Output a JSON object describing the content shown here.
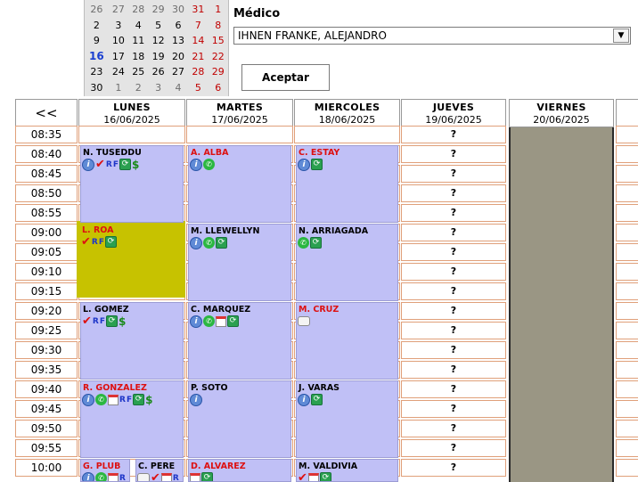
{
  "mini_calendar": {
    "weeks": [
      [
        {
          "d": "26",
          "c": "other"
        },
        {
          "d": "27",
          "c": "other"
        },
        {
          "d": "28",
          "c": "other"
        },
        {
          "d": "29",
          "c": "other"
        },
        {
          "d": "30",
          "c": "other"
        },
        {
          "d": "31",
          "c": "red other"
        },
        {
          "d": "1",
          "c": "red"
        }
      ],
      [
        {
          "d": "2",
          "c": ""
        },
        {
          "d": "3",
          "c": ""
        },
        {
          "d": "4",
          "c": ""
        },
        {
          "d": "5",
          "c": ""
        },
        {
          "d": "6",
          "c": ""
        },
        {
          "d": "7",
          "c": "red"
        },
        {
          "d": "8",
          "c": "red"
        }
      ],
      [
        {
          "d": "9",
          "c": ""
        },
        {
          "d": "10",
          "c": ""
        },
        {
          "d": "11",
          "c": ""
        },
        {
          "d": "12",
          "c": ""
        },
        {
          "d": "13",
          "c": ""
        },
        {
          "d": "14",
          "c": "red"
        },
        {
          "d": "15",
          "c": "red"
        }
      ],
      [
        {
          "d": "16",
          "c": "today"
        },
        {
          "d": "17",
          "c": ""
        },
        {
          "d": "18",
          "c": ""
        },
        {
          "d": "19",
          "c": ""
        },
        {
          "d": "20",
          "c": ""
        },
        {
          "d": "21",
          "c": "red"
        },
        {
          "d": "22",
          "c": "red"
        }
      ],
      [
        {
          "d": "23",
          "c": ""
        },
        {
          "d": "24",
          "c": ""
        },
        {
          "d": "25",
          "c": ""
        },
        {
          "d": "26",
          "c": ""
        },
        {
          "d": "27",
          "c": ""
        },
        {
          "d": "28",
          "c": "red"
        },
        {
          "d": "29",
          "c": "red"
        }
      ],
      [
        {
          "d": "30",
          "c": ""
        },
        {
          "d": "1",
          "c": "other"
        },
        {
          "d": "2",
          "c": "other"
        },
        {
          "d": "3",
          "c": "other"
        },
        {
          "d": "4",
          "c": "other"
        },
        {
          "d": "5",
          "c": "red other"
        },
        {
          "d": "6",
          "c": "red other"
        }
      ]
    ]
  },
  "medico": {
    "label": "Médico",
    "selected": "IHNEN FRANKE, ALEJANDRO",
    "accept_label": "Aceptar"
  },
  "schedule": {
    "nav_prev": "<<",
    "days": [
      {
        "name": "LUNES",
        "date": "16/06/2025"
      },
      {
        "name": "MARTES",
        "date": "17/06/2025"
      },
      {
        "name": "MIERCOLES",
        "date": "18/06/2025"
      },
      {
        "name": "JUEVES",
        "date": "19/06/2025"
      },
      {
        "name": "VIERNES",
        "date": "20/06/2025"
      }
    ],
    "times": [
      "08:35",
      "08:40",
      "08:45",
      "08:50",
      "08:55",
      "09:00",
      "09:05",
      "09:10",
      "09:15",
      "09:20",
      "09:25",
      "09:30",
      "09:35",
      "09:40",
      "09:45",
      "09:50",
      "09:55",
      "10:00"
    ],
    "unassigned_symbol": "?",
    "appointments": [
      {
        "day": 0,
        "start": 1,
        "slots": 4,
        "name": "N. TUSEDDU",
        "red": false,
        "icons": [
          "info",
          "check",
          "R",
          "F",
          "sync",
          "dollar"
        ]
      },
      {
        "day": 1,
        "start": 1,
        "slots": 4,
        "name": "A. ALBA",
        "red": true,
        "icons": [
          "info",
          "wa"
        ]
      },
      {
        "day": 2,
        "start": 1,
        "slots": 4,
        "name": "C. ESTAY",
        "red": true,
        "icons": [
          "info",
          "sync"
        ]
      },
      {
        "day": 0,
        "start": 5,
        "slots": 4,
        "name": "L. ROA",
        "red": true,
        "icons": [
          "check",
          "R",
          "F",
          "sync"
        ]
      },
      {
        "day": 1,
        "start": 5,
        "slots": 4,
        "name": "M. LLEWELLYN",
        "red": false,
        "icons": [
          "info",
          "wa",
          "sync"
        ]
      },
      {
        "day": 2,
        "start": 5,
        "slots": 4,
        "name": "N. ARRIAGADA",
        "red": false,
        "icons": [
          "wa",
          "sync"
        ]
      },
      {
        "day": 0,
        "start": 9,
        "slots": 4,
        "name": "L. GOMEZ",
        "red": false,
        "icons": [
          "check",
          "R",
          "F",
          "sync",
          "dollar"
        ]
      },
      {
        "day": 1,
        "start": 9,
        "slots": 4,
        "name": "C. MARQUEZ",
        "red": false,
        "icons": [
          "info",
          "wa",
          "cal",
          "sync"
        ]
      },
      {
        "day": 2,
        "start": 9,
        "slots": 4,
        "name": "M. CRUZ",
        "red": true,
        "icons": [
          "chat"
        ]
      },
      {
        "day": 0,
        "start": 13,
        "slots": 4,
        "name": "R. GONZALEZ",
        "red": true,
        "icons": [
          "info",
          "wa",
          "cal",
          "R",
          "F",
          "sync",
          "dollar"
        ]
      },
      {
        "day": 1,
        "start": 13,
        "slots": 4,
        "name": "P. SOTO",
        "red": false,
        "icons": [
          "info"
        ]
      },
      {
        "day": 2,
        "start": 13,
        "slots": 4,
        "name": "J. VARAS",
        "red": false,
        "icons": [
          "info",
          "sync"
        ]
      },
      {
        "day": 0,
        "start": 17,
        "slots": 2,
        "half": "left",
        "name": "G. PLUB",
        "red": true,
        "icons": [
          "info",
          "wa",
          "cal",
          "R"
        ]
      },
      {
        "day": 0,
        "start": 17,
        "slots": 2,
        "half": "right",
        "name": "C. PERE",
        "red": false,
        "icons": [
          "chat",
          "check",
          "cal",
          "R"
        ]
      },
      {
        "day": 1,
        "start": 17,
        "slots": 2,
        "name": "D. ALVAREZ",
        "red": true,
        "icons": [
          "cal",
          "sync"
        ]
      },
      {
        "day": 2,
        "start": 17,
        "slots": 2,
        "name": "M. VALDIVIA",
        "red": false,
        "icons": [
          "check",
          "cal",
          "sync"
        ]
      }
    ]
  },
  "colors": {
    "appointment_bg": "#c0c0f6",
    "slot_border": "#e0a07a",
    "blocked_day_bg": "#9a9684",
    "highlight_bg": "#c7c200",
    "patient_red": "#dd1010"
  }
}
